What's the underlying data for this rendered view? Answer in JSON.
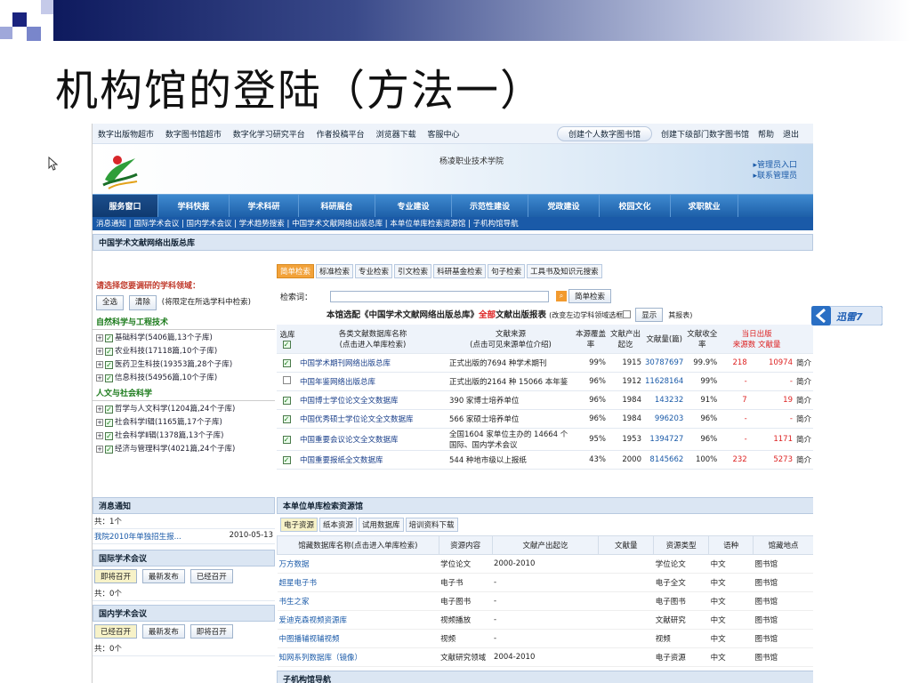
{
  "slide": {
    "title": "机构馆的登陆（方法一）"
  },
  "topnav": {
    "left": [
      "数字出版物超市",
      "数字图书馆超市",
      "数字化学习研究平台",
      "作者投稿平台",
      "浏览器下载",
      "客服中心"
    ],
    "create_personal": "创建个人数字图书馆",
    "right": [
      "创建下级部门数字图书馆",
      "帮助",
      "退出"
    ]
  },
  "banner": {
    "school": "杨凌职业技术学院",
    "admin_login": "管理员入口",
    "contact_admin": "联系管理员"
  },
  "mainnav": [
    "服务窗口",
    "学科快报",
    "学术科研",
    "科研展台",
    "专业建设",
    "示范性建设",
    "党政建设",
    "校园文化",
    "求职就业"
  ],
  "subnav": "消息通知 | 国际学术会议 | 国内学术会议 | 学术趋势搜索 | 中国学术文献网络出版总库 | 本单位单库检索资源馆 | 子机构馆导航",
  "cnki": {
    "heading": "中国学术文献网络出版总库",
    "tabs": [
      "简单检索",
      "标准检索",
      "专业检索",
      "引文检索",
      "科研基金检索",
      "句子检索",
      "工具书及知识元搜索"
    ],
    "search_label": "检索词：",
    "search_button": "简单检索",
    "select_notice": "本馆选配《中国学术文献网络出版总库》",
    "select_all_label": "全部",
    "select_notice_2": "文献出版报表",
    "select_hint": "(改变左边学科领域选框",
    "display_button": "显示",
    "report_label": "其报表)",
    "columns": {
      "select": "选库",
      "name": "各类文献数据库名称",
      "name_sub": "(点击进入单库检索)",
      "source": "文献来源",
      "source_sub": "(点击可见来源单位介绍)",
      "coverage": "本源覆盖率",
      "start": "文献产出起讫",
      "amount": "文献量(篇)",
      "fulltext": "文献收全率",
      "today": "当日出版",
      "today_sources": "来源数",
      "today_docs": "文献量"
    },
    "rows": [
      {
        "checked": true,
        "name": "中国学术期刊网络出版总库",
        "source": "正式出版的7694 种学术期刊",
        "coverage": "99%",
        "start": "1915",
        "amount": "30787697",
        "fulltext": "99.9%",
        "today_src": "218",
        "today_docs": "10974",
        "intro": "简介"
      },
      {
        "checked": false,
        "name": "中国年鉴网络出版总库",
        "source": "正式出版的2164 种 15066 本年鉴",
        "coverage": "96%",
        "start": "1912",
        "amount": "11628164",
        "fulltext": "99%",
        "today_src": "-",
        "today_docs": "-",
        "intro": "简介"
      },
      {
        "checked": true,
        "name": "中国博士学位论文全文数据库",
        "source": "390 家博士培养单位",
        "coverage": "96%",
        "start": "1984",
        "amount": "143232",
        "fulltext": "91%",
        "today_src": "7",
        "today_docs": "19",
        "intro": "简介"
      },
      {
        "checked": true,
        "name": "中国优秀硕士学位论文全文数据库",
        "source": "566 家硕士培养单位",
        "coverage": "96%",
        "start": "1984",
        "amount": "996203",
        "fulltext": "96%",
        "today_src": "-",
        "today_docs": "-",
        "intro": "简介"
      },
      {
        "checked": true,
        "name": "中国重要会议论文全文数据库",
        "source": "全国1604 家单位主办的 14664 个国际、国内学术会议",
        "coverage": "95%",
        "start": "1953",
        "amount": "1394727",
        "fulltext": "96%",
        "today_src": "-",
        "today_docs": "1171",
        "intro": "简介"
      },
      {
        "checked": true,
        "name": "中国重要报纸全文数据库",
        "source": "544 种地市级以上报纸",
        "coverage": "43%",
        "start": "2000",
        "amount": "8145662",
        "fulltext": "100%",
        "today_src": "232",
        "today_docs": "5273",
        "intro": "简介"
      }
    ]
  },
  "subjects": {
    "heading": "请选择您要调研的学科领域：",
    "select_all": "全选",
    "clear": "清除",
    "hint": "(将限定在所选学科中检索)",
    "groups": [
      {
        "name": "自然科学与工程技术",
        "items": [
          "基础科学(5406篇,13个子库)",
          "农业科技(17118篇,10个子库)",
          "医药卫生科技(19353篇,28个子库)",
          "信息科技(54956篇,10个子库)"
        ]
      },
      {
        "name": "人文与社会科学",
        "items": [
          "哲学与人文科学(1204篇,24个子库)",
          "社会科学Ⅰ辑(1165篇,17个子库)",
          "社会科学Ⅱ辑(1378篇,13个子库)",
          "经济与管理科学(4021篇,24个子库)"
        ]
      }
    ]
  },
  "news": {
    "heading": "消息通知",
    "count": "共：1个",
    "item": "我院2010年单独招生报...",
    "date": "2010-05-13"
  },
  "intl": {
    "heading": "国际学术会议",
    "buttons": [
      "即将召开",
      "最新发布",
      "已经召开"
    ],
    "count": "共：0个"
  },
  "domestic": {
    "heading": "国内学术会议",
    "buttons": [
      "已经召开",
      "最新发布",
      "即将召开"
    ],
    "count": "共：0个"
  },
  "resources": {
    "heading": "本单位单库检索资源馆",
    "tabs": [
      "电子资源",
      "纸本资源",
      "试用数据库",
      "培训资料下载"
    ],
    "columns": [
      "馆藏数据库名称(点击进入单库检索)",
      "资源内容",
      "文献产出起讫",
      "文献量",
      "资源类型",
      "语种",
      "馆藏地点"
    ],
    "rows": [
      {
        "name": "万方数据",
        "content": "学位论文",
        "period": "2000-2010",
        "amount": "",
        "type": "学位论文",
        "lang": "中文",
        "place": "图书馆"
      },
      {
        "name": "超星电子书",
        "content": "电子书",
        "period": "-",
        "amount": "",
        "type": "电子全文",
        "lang": "中文",
        "place": "图书馆"
      },
      {
        "name": "书生之家",
        "content": "电子图书",
        "period": "-",
        "amount": "",
        "type": "电子图书",
        "lang": "中文",
        "place": "图书馆"
      },
      {
        "name": "爱迪克森视频资源库",
        "content": "视频播放",
        "period": "-",
        "amount": "",
        "type": "文献研究",
        "lang": "中文",
        "place": "图书馆"
      },
      {
        "name": "中图播辅视辅视频",
        "content": "视频",
        "period": "-",
        "amount": "",
        "type": "视频",
        "lang": "中文",
        "place": "图书馆"
      },
      {
        "name": "知网系列数据库（镜像）",
        "content": "文献研究领域",
        "period": "2004-2010",
        "amount": "",
        "type": "电子资源",
        "lang": "中文",
        "place": "图书馆"
      }
    ]
  },
  "sub_org": {
    "heading": "子机构馆导航"
  },
  "badge": {
    "label": "迅雷7"
  },
  "colors": {
    "nav_blue": "#1d5fa8",
    "active_tab": "#f2a23a",
    "heading_red": "#c0392b",
    "category_green": "#1a7a1a"
  }
}
